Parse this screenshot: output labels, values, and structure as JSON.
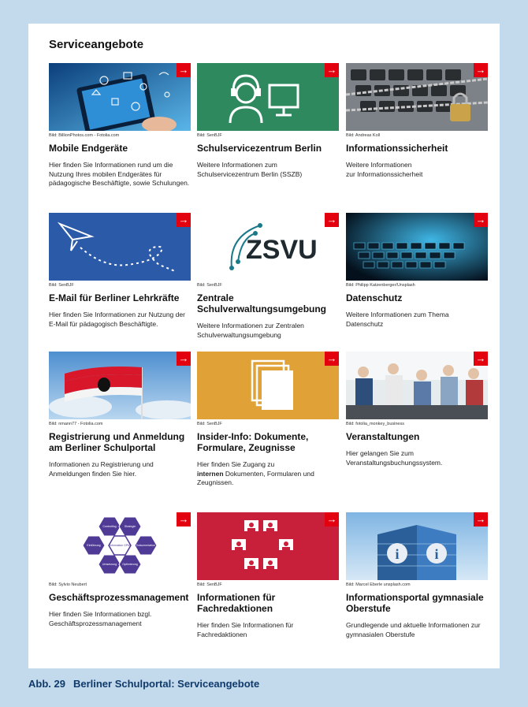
{
  "page_title": "Serviceangebote",
  "arrow_icon": "arrow-right-icon",
  "accent_color": "#e3000f",
  "cards": [
    {
      "credit": "Bild: BillionPhotos.com - Fotolia.com",
      "title": "Mobile Endgeräte",
      "desc": "Hier finden Sie Informationen rund um die Nutzung Ihres mobilen Endgerätes für pädagogische Beschäftigte, sowie Schulungen."
    },
    {
      "credit": "Bild: SenBJF",
      "title": "Schulservicezentrum Berlin",
      "desc": "Weitere Informationen zum Schulservicezentrum Berlin (SSZB)"
    },
    {
      "credit": "Bild: Andreas Koll",
      "title": "Informationssicherheit",
      "desc_lines": [
        "Weitere Informationen",
        "zur Informationssicherheit"
      ]
    },
    {
      "credit": "Bild: SenBJF",
      "title": "E-Mail für Berliner Lehrkräfte",
      "desc": "Hier finden Sie Informationen zur Nutzung der E-Mail für pädagogisch Beschäftigte."
    },
    {
      "credit": "Bild: SenBJF",
      "title": "Zentrale Schulverwaltungsumgebung",
      "desc": "Weitere Informationen zur Zentralen Schulverwaltungsumgebung",
      "logo_text": "ZSVU"
    },
    {
      "credit": "Bild: Philipp Katzenberger/Unsplash",
      "title": "Datenschutz",
      "desc": "Weitere Informationen zum Thema Datenschutz"
    },
    {
      "credit": "Bild: nmann77 - Fotolia.com",
      "title": "Registrierung und Anmeldung am Berliner Schulportal",
      "desc": "Informationen zu Registrierung und Anmeldungen finden Sie hier."
    },
    {
      "credit": "Bild: SenBJF",
      "title": "Insider-Info: Dokumente, Formulare, Zeugnisse",
      "desc_pre": "Hier finden Sie Zugang zu",
      "desc_bold": "internen",
      "desc_post": "Dokumenten, Formularen und Zeugnissen."
    },
    {
      "credit": "Bild: fotolia_monkey_business",
      "title": "Veranstaltungen",
      "desc": "Hier gelangen Sie zum Veranstaltungsbuchungssystem."
    },
    {
      "credit": "Bild: Sylvio Neubert",
      "title": "Geschäftsprozessmanagement",
      "desc": "Hier finden Sie Informationen bzgl. Geschäftsprozessmanagement",
      "hex_labels": [
        "Controlling",
        "Strategie",
        "Einführung",
        "Information GPM",
        "Dokumentation",
        "Umsetzung",
        "Optimierung"
      ]
    },
    {
      "credit": "Bild: SenBJF",
      "title": "Informationen für Fachredaktionen",
      "desc": "Hier finden Sie Informationen für Fachredaktionen"
    },
    {
      "credit": "Bild: Marcel Eberle unsplash.com",
      "title": "Informationsportal gymnasiale Oberstufe",
      "desc": "Grundlegende und aktuelle Informationen zur gymnasialen Oberstufe"
    }
  ],
  "caption": {
    "number": "Abb. 29",
    "text": "Berliner Schulportal: Serviceangebote"
  }
}
